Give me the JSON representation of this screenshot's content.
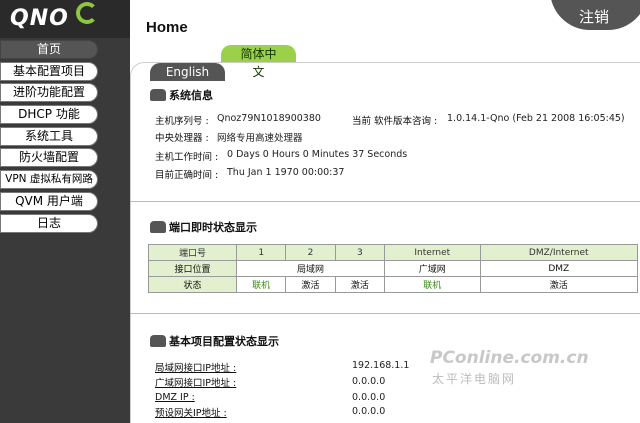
{
  "brand": {
    "logo": "QNO"
  },
  "sidebar": {
    "items": [
      {
        "label": "首页",
        "active": true
      },
      {
        "label": "基本配置项目"
      },
      {
        "label": "进阶功能配置"
      },
      {
        "label": "DHCP 功能"
      },
      {
        "label": "系统工具"
      },
      {
        "label": "防火墙配置"
      },
      {
        "label": "VPN 虚拟私有网路"
      },
      {
        "label": "QVM 用户端"
      },
      {
        "label": "日志"
      }
    ]
  },
  "header": {
    "title": "Home",
    "logout": "注销"
  },
  "tabs": [
    {
      "label": "English"
    },
    {
      "label": "简体中文"
    }
  ],
  "system_info": {
    "title": "系统信息",
    "serial_label": "主机序列号 :",
    "serial_value": "Qnoz79N1018900380",
    "firmware_label": "当前 软件版本咨询 :",
    "firmware_value": "1.0.14.1-Qno (Feb 21 2008 16:05:45)",
    "cpu_label": "中央处理器 :",
    "cpu_value": "网络专用高速处理器",
    "uptime_label": "主机工作时间 :",
    "uptime_value": "0 Days 0 Hours 0 Minutes 37 Seconds",
    "time_label": "目前正确时间 :",
    "time_value": "Thu Jan 1 1970 00:00:37"
  },
  "port_status": {
    "title": "端口即时状态显示",
    "header": [
      "端口号",
      "1",
      "2",
      "3",
      "Internet",
      "DMZ/Internet"
    ],
    "location_label": "接口位置",
    "lan_label": "局域网",
    "wan_label": "广域网",
    "dmz_label": "DMZ",
    "status_label": "状态",
    "statuses": [
      "联机",
      "激活",
      "激活",
      "联机",
      "激活"
    ]
  },
  "basic_config": {
    "title": "基本项目配置状态显示",
    "rows": [
      {
        "label": "局域网接口IP地址 :",
        "value": "192.168.1.1"
      },
      {
        "label": "广域网接口IP地址 :",
        "value": "0.0.0.0"
      },
      {
        "label": "DMZ IP :",
        "value": "0.0.0.0"
      },
      {
        "label": "预设网关IP地址 :",
        "value": "0.0.0.0"
      }
    ]
  },
  "watermark": {
    "line1": "PConline.com.cn",
    "line2": "太平洋电脑网"
  },
  "colors": {
    "accent": "#9ad04a",
    "dark": "#3a3a3a",
    "table_header": "#e2f0cf",
    "link_green": "#3a8a16"
  }
}
